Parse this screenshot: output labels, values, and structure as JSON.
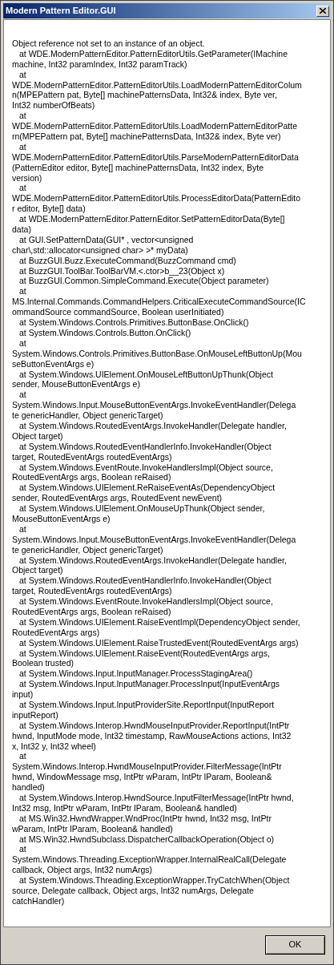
{
  "window": {
    "title": "Modern Pattern Editor.GUI"
  },
  "message": {
    "lines": [
      {
        "text": "Object reference not set to an instance of an object.",
        "indent": false
      },
      {
        "text": "at WDE.ModernPatternEditor.PatternEditorUtils.GetParameter(IMachine",
        "indent": true
      },
      {
        "text": "machine, Int32 paramIndex, Int32 paramTrack)",
        "indent": false
      },
      {
        "text": "at",
        "indent": true
      },
      {
        "text": "WDE.ModernPatternEditor.PatternEditorUtils.LoadModernPatternEditorColum",
        "indent": false
      },
      {
        "text": "n(MPEPattern pat, Byte[] machinePatternsData, Int32& index, Byte ver,",
        "indent": false
      },
      {
        "text": "Int32 numberOfBeats)",
        "indent": false
      },
      {
        "text": "at",
        "indent": true
      },
      {
        "text": "WDE.ModernPatternEditor.PatternEditorUtils.LoadModernPatternEditorPatte",
        "indent": false
      },
      {
        "text": "rn(MPEPattern pat, Byte[] machinePatternsData, Int32& index, Byte ver)",
        "indent": false
      },
      {
        "text": "at",
        "indent": true
      },
      {
        "text": "WDE.ModernPatternEditor.PatternEditorUtils.ParseModernPatternEditorData",
        "indent": false
      },
      {
        "text": "(PatternEditor editor, Byte[] machinePatternsData, Int32 index, Byte",
        "indent": false
      },
      {
        "text": "version)",
        "indent": false
      },
      {
        "text": "at",
        "indent": true
      },
      {
        "text": "WDE.ModernPatternEditor.PatternEditorUtils.ProcessEditorData(PatternEdito",
        "indent": false
      },
      {
        "text": "r editor, Byte[] data)",
        "indent": false
      },
      {
        "text": "at WDE.ModernPatternEditor.PatternEditor.SetPatternEditorData(Byte[]",
        "indent": true
      },
      {
        "text": "data)",
        "indent": false
      },
      {
        "text": "at GUI.SetPatternData(GUI* , vector<unsigned",
        "indent": true
      },
      {
        "text": "char\\,std::allocator<unsigned char> >* myData)",
        "indent": false
      },
      {
        "text": "at BuzzGUI.Buzz.ExecuteCommand(BuzzCommand cmd)",
        "indent": true
      },
      {
        "text": "at BuzzGUI.ToolBar.ToolBarVM.<.ctor>b__23(Object x)",
        "indent": true
      },
      {
        "text": "at BuzzGUI.Common.SimpleCommand.Execute(Object parameter)",
        "indent": true
      },
      {
        "text": "at",
        "indent": true
      },
      {
        "text": "MS.Internal.Commands.CommandHelpers.CriticalExecuteCommandSource(IC",
        "indent": false
      },
      {
        "text": "ommandSource commandSource, Boolean userInitiated)",
        "indent": false
      },
      {
        "text": "at System.Windows.Controls.Primitives.ButtonBase.OnClick()",
        "indent": true
      },
      {
        "text": "at System.Windows.Controls.Button.OnClick()",
        "indent": true
      },
      {
        "text": "at",
        "indent": true
      },
      {
        "text": "System.Windows.Controls.Primitives.ButtonBase.OnMouseLeftButtonUp(Mou",
        "indent": false
      },
      {
        "text": "seButtonEventArgs e)",
        "indent": false
      },
      {
        "text": "at System.Windows.UIElement.OnMouseLeftButtonUpThunk(Object",
        "indent": true
      },
      {
        "text": "sender, MouseButtonEventArgs e)",
        "indent": false
      },
      {
        "text": "at",
        "indent": true
      },
      {
        "text": "System.Windows.Input.MouseButtonEventArgs.InvokeEventHandler(Delega",
        "indent": false
      },
      {
        "text": "te genericHandler, Object genericTarget)",
        "indent": false
      },
      {
        "text": "at System.Windows.RoutedEventArgs.InvokeHandler(Delegate handler,",
        "indent": true
      },
      {
        "text": "Object target)",
        "indent": false
      },
      {
        "text": "at System.Windows.RoutedEventHandlerInfo.InvokeHandler(Object",
        "indent": true
      },
      {
        "text": "target, RoutedEventArgs routedEventArgs)",
        "indent": false
      },
      {
        "text": "at System.Windows.EventRoute.InvokeHandlersImpl(Object source,",
        "indent": true
      },
      {
        "text": "RoutedEventArgs args, Boolean reRaised)",
        "indent": false
      },
      {
        "text": "at System.Windows.UIElement.ReRaiseEventAs(DependencyObject",
        "indent": true
      },
      {
        "text": "sender, RoutedEventArgs args, RoutedEvent newEvent)",
        "indent": false
      },
      {
        "text": "at System.Windows.UIElement.OnMouseUpThunk(Object sender,",
        "indent": true
      },
      {
        "text": "MouseButtonEventArgs e)",
        "indent": false
      },
      {
        "text": "at",
        "indent": true
      },
      {
        "text": "System.Windows.Input.MouseButtonEventArgs.InvokeEventHandler(Delega",
        "indent": false
      },
      {
        "text": "te genericHandler, Object genericTarget)",
        "indent": false
      },
      {
        "text": "at System.Windows.RoutedEventArgs.InvokeHandler(Delegate handler,",
        "indent": true
      },
      {
        "text": "Object target)",
        "indent": false
      },
      {
        "text": "at System.Windows.RoutedEventHandlerInfo.InvokeHandler(Object",
        "indent": true
      },
      {
        "text": "target, RoutedEventArgs routedEventArgs)",
        "indent": false
      },
      {
        "text": "at System.Windows.EventRoute.InvokeHandlersImpl(Object source,",
        "indent": true
      },
      {
        "text": "RoutedEventArgs args, Boolean reRaised)",
        "indent": false
      },
      {
        "text": "at System.Windows.UIElement.RaiseEventImpl(DependencyObject sender,",
        "indent": true
      },
      {
        "text": "RoutedEventArgs args)",
        "indent": false
      },
      {
        "text": "at System.Windows.UIElement.RaiseTrustedEvent(RoutedEventArgs args)",
        "indent": true
      },
      {
        "text": "at System.Windows.UIElement.RaiseEvent(RoutedEventArgs args,",
        "indent": true
      },
      {
        "text": "Boolean trusted)",
        "indent": false
      },
      {
        "text": "at System.Windows.Input.InputManager.ProcessStagingArea()",
        "indent": true
      },
      {
        "text": "at System.Windows.Input.InputManager.ProcessInput(InputEventArgs",
        "indent": true
      },
      {
        "text": "input)",
        "indent": false
      },
      {
        "text": "at System.Windows.Input.InputProviderSite.ReportInput(InputReport",
        "indent": true
      },
      {
        "text": "inputReport)",
        "indent": false
      },
      {
        "text": "at System.Windows.Interop.HwndMouseInputProvider.ReportInput(IntPtr",
        "indent": true
      },
      {
        "text": "hwnd, InputMode mode, Int32 timestamp, RawMouseActions actions, Int32",
        "indent": false
      },
      {
        "text": "x, Int32 y, Int32 wheel)",
        "indent": false
      },
      {
        "text": "at",
        "indent": true
      },
      {
        "text": "System.Windows.Interop.HwndMouseInputProvider.FilterMessage(IntPtr",
        "indent": false
      },
      {
        "text": "hwnd, WindowMessage msg, IntPtr wParam, IntPtr lParam, Boolean&",
        "indent": false
      },
      {
        "text": "handled)",
        "indent": false
      },
      {
        "text": "at System.Windows.Interop.HwndSource.InputFilterMessage(IntPtr hwnd,",
        "indent": true
      },
      {
        "text": "Int32 msg, IntPtr wParam, IntPtr lParam, Boolean& handled)",
        "indent": false
      },
      {
        "text": "at MS.Win32.HwndWrapper.WndProc(IntPtr hwnd, Int32 msg, IntPtr",
        "indent": true
      },
      {
        "text": "wParam, IntPtr lParam, Boolean& handled)",
        "indent": false
      },
      {
        "text": "at MS.Win32.HwndSubclass.DispatcherCallbackOperation(Object o)",
        "indent": true
      },
      {
        "text": "at",
        "indent": true
      },
      {
        "text": "System.Windows.Threading.ExceptionWrapper.InternalRealCall(Delegate",
        "indent": false
      },
      {
        "text": "callback, Object args, Int32 numArgs)",
        "indent": false
      },
      {
        "text": "at System.Windows.Threading.ExceptionWrapper.TryCatchWhen(Object",
        "indent": true
      },
      {
        "text": "source, Delegate callback, Object args, Int32 numArgs, Delegate",
        "indent": false
      },
      {
        "text": "catchHandler)",
        "indent": false
      }
    ]
  },
  "buttons": [
    {
      "label": "OK"
    }
  ]
}
